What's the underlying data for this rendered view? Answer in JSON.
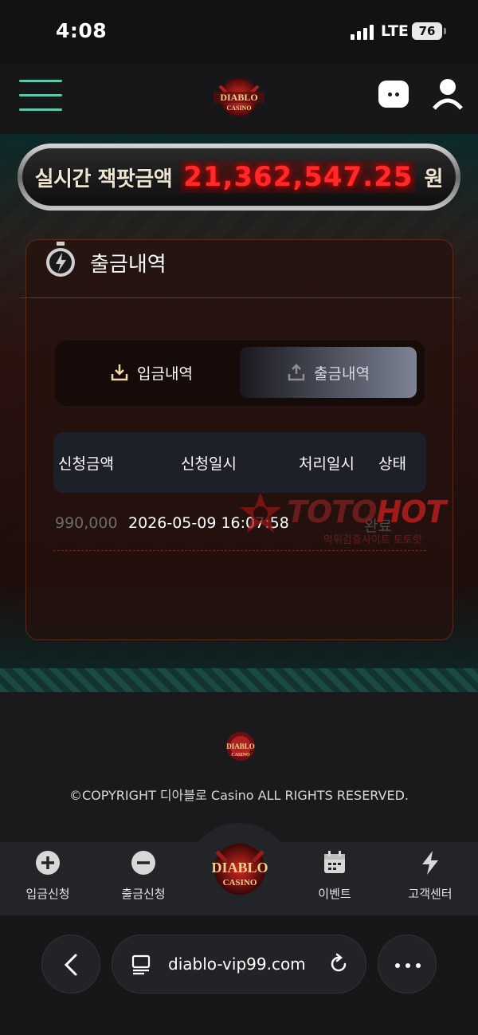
{
  "status_bar": {
    "time": "4:08",
    "network": "LTE",
    "battery": "76"
  },
  "header": {
    "logo_text": "DIABLO CASINO"
  },
  "jackpot": {
    "label": "실시간 잭팟금액",
    "amount": "21,362,547.25",
    "unit": "원"
  },
  "panel": {
    "title": "출금내역",
    "tabs": [
      {
        "label": "입금내역",
        "active": false
      },
      {
        "label": "출금내역",
        "active": true
      }
    ],
    "table": {
      "headers": [
        "신청금액",
        "신청일시",
        "처리일시",
        "상태"
      ],
      "rows": [
        {
          "amount": "990,000",
          "requested_at": "2026-05-09 16:07:58",
          "status": "완료"
        }
      ]
    }
  },
  "watermark": {
    "brand_a": "TOTO",
    "brand_b": "HOT",
    "sub": "먹튀검증사이트 토토핫"
  },
  "footer": {
    "copyright": "©COPYRIGHT 디아블로 Casino ALL RIGHTS RESERVED."
  },
  "bottom_nav": {
    "items": [
      {
        "label": "입금신청",
        "icon": "plus-circle-icon"
      },
      {
        "label": "출금신청",
        "icon": "minus-circle-icon"
      },
      {
        "label": "이벤트",
        "icon": "calendar-icon"
      },
      {
        "label": "고객센터",
        "icon": "lightning-icon"
      }
    ]
  },
  "browser": {
    "url": "diablo-vip99.com"
  },
  "colors": {
    "accent_teal": "#5cc9a8",
    "jackpot_red": "#ff2a2a",
    "panel_border": "#5a2a1c"
  }
}
